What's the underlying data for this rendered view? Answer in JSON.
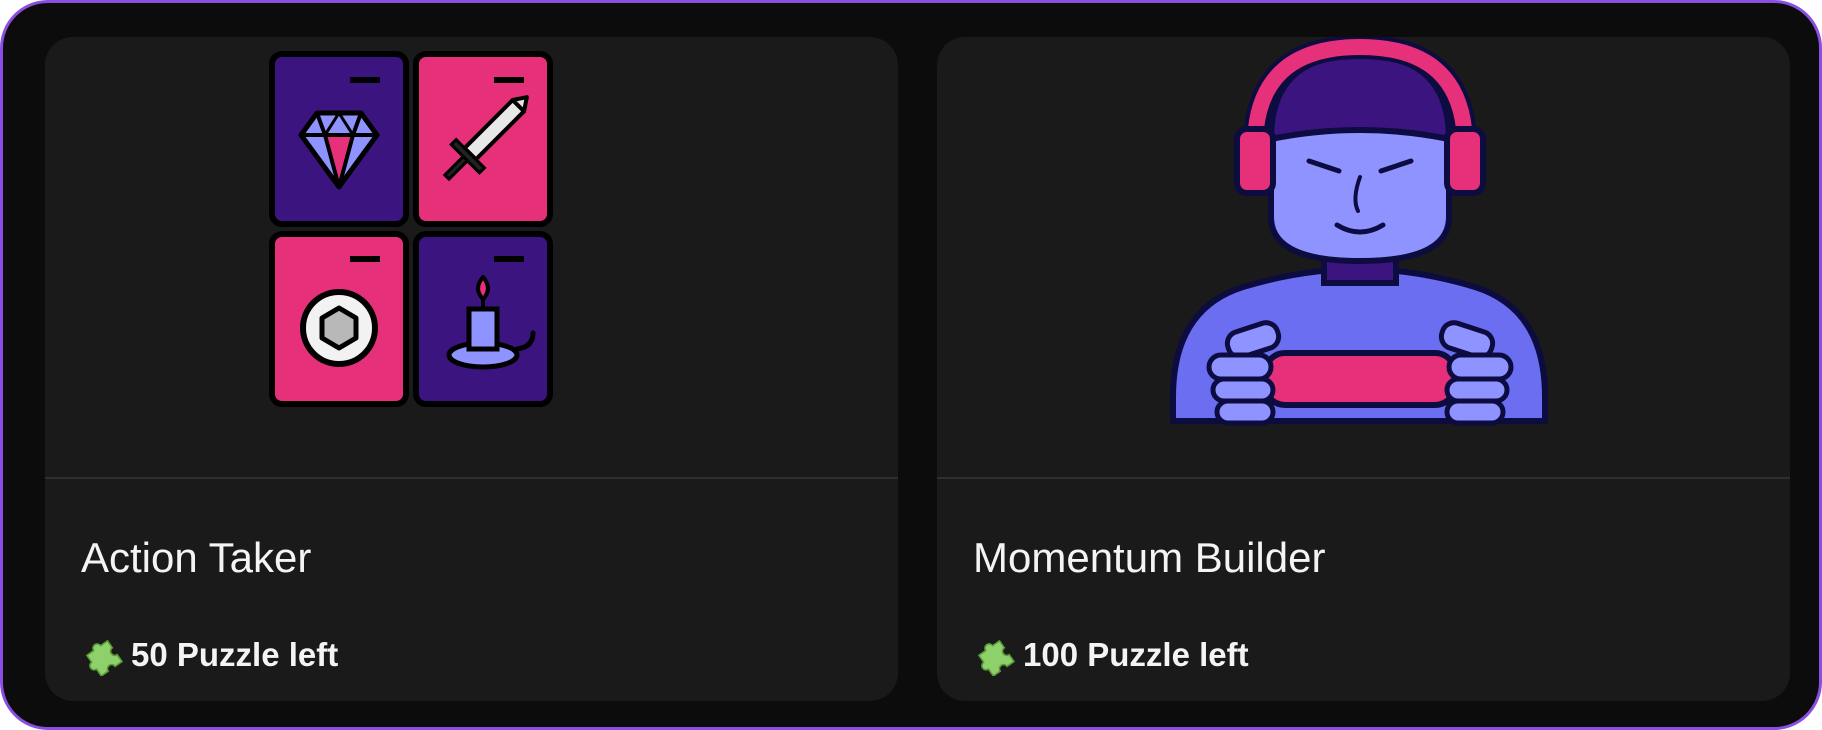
{
  "cards": [
    {
      "title": "Action Taker",
      "icon": "cards-icon",
      "puzzles_left": "50 Puzzle left"
    },
    {
      "title": "Momentum Builder",
      "icon": "gamer-icon",
      "puzzles_left": "100 Puzzle left"
    }
  ],
  "colors": {
    "frame_border": "#8a4fe0",
    "background": "#0c0c0c",
    "card": "#1a1a1a",
    "pink": "#e6307a",
    "purple": "#3c1480",
    "lavender": "#8f93ff",
    "puzzle_green": "#8ed16a"
  }
}
